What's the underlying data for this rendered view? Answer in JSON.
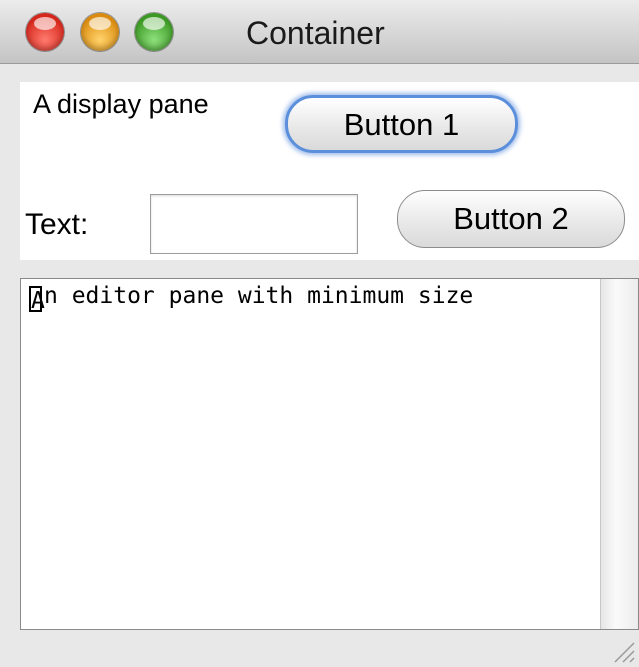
{
  "window": {
    "title": "Container"
  },
  "top_panel": {
    "display_label": "A display pane",
    "button1_label": "Button 1"
  },
  "form_row": {
    "text_label": "Text:",
    "text_value": "",
    "button2_label": "Button 2"
  },
  "editor": {
    "first_char": "A",
    "rest_text": "n editor pane with minimum size"
  },
  "icons": {
    "close": "close-light-icon",
    "minimize": "minimize-light-icon",
    "zoom": "zoom-light-icon",
    "resize": "resize-grip-icon"
  },
  "colors": {
    "close": "#d8281d",
    "minimize": "#dd8d10",
    "zoom": "#3d9b25",
    "focus_ring": "#5b8fdb"
  }
}
